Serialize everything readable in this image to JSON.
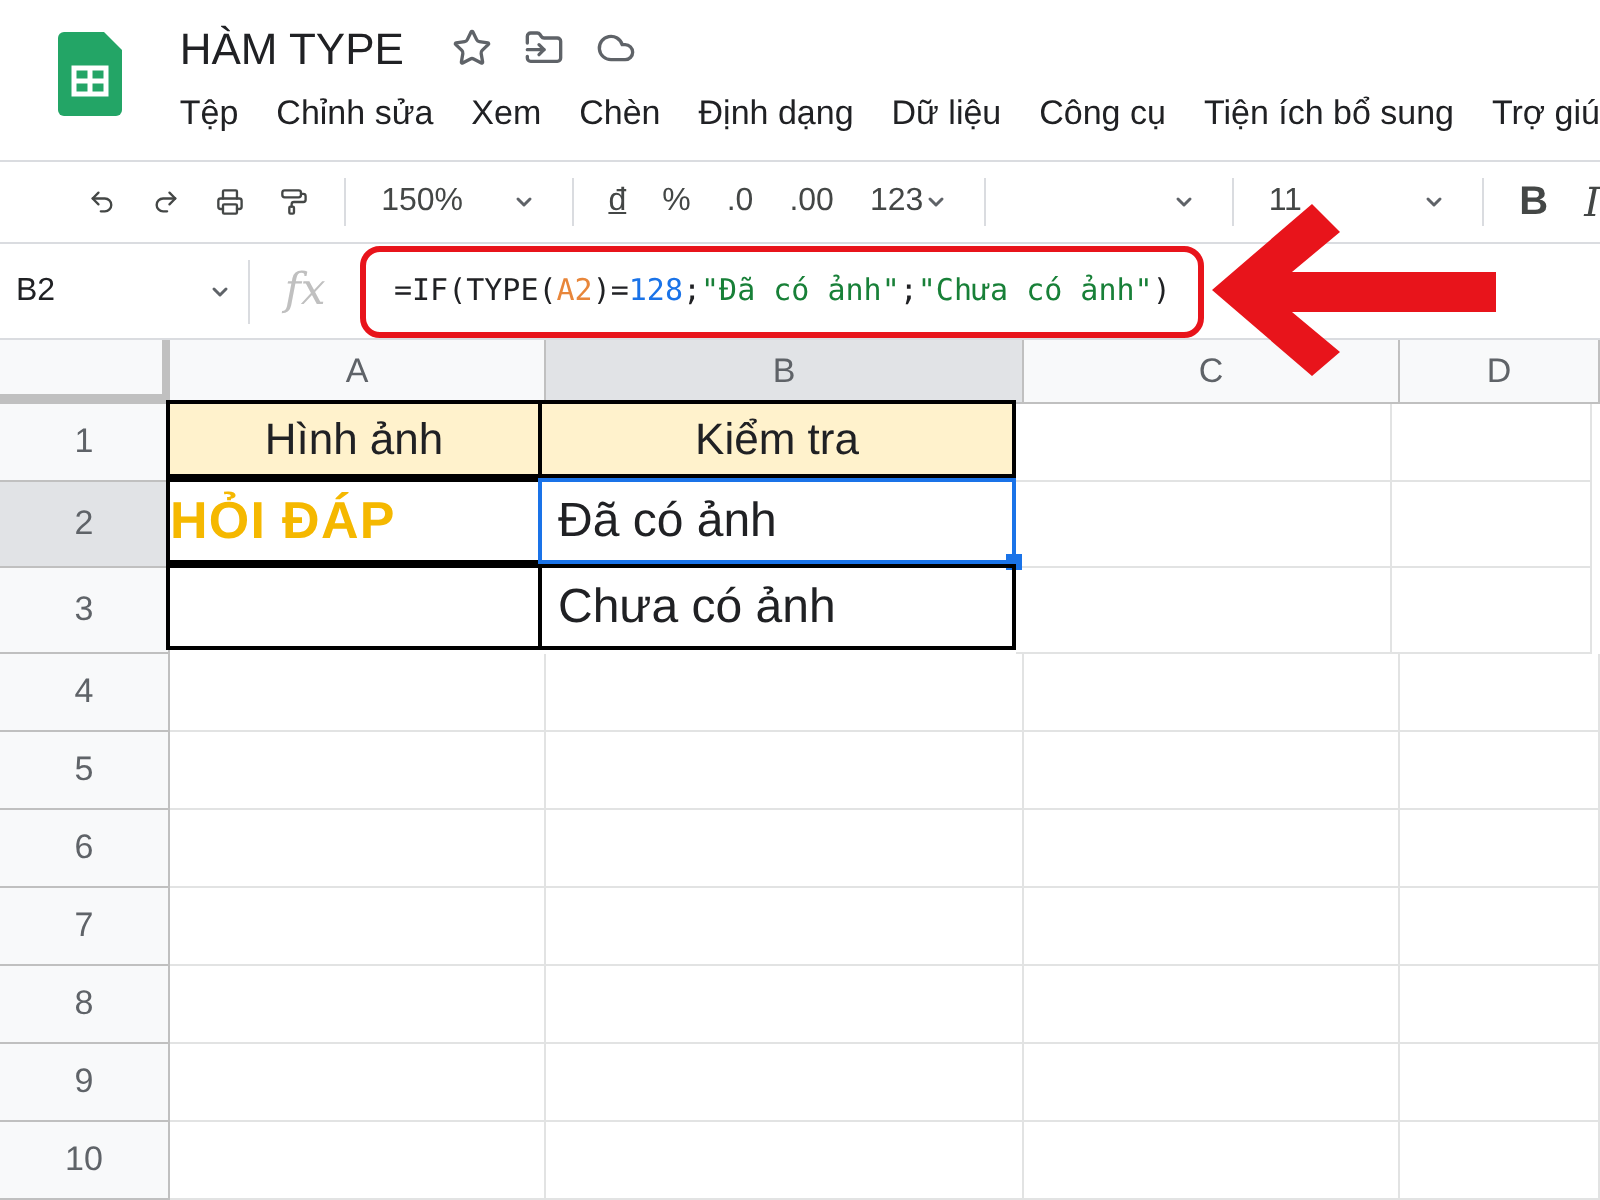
{
  "doc": {
    "title": "HÀM TYPE"
  },
  "menu": [
    "Tệp",
    "Chỉnh sửa",
    "Xem",
    "Chèn",
    "Định dạng",
    "Dữ liệu",
    "Công cụ",
    "Tiện ích bổ sung",
    "Trợ giú"
  ],
  "toolbar": {
    "zoom": "150%",
    "currency": "đ",
    "percent": "%",
    "decimal_less": ".0",
    "decimal_more": ".00",
    "format": "123",
    "font_size": "11",
    "bold": "B",
    "italic": "I"
  },
  "formula_bar": {
    "cell_ref": "B2",
    "fx": "fx",
    "formula": [
      {
        "kind": "text",
        "text": "=IF(TYPE("
      },
      {
        "kind": "ref",
        "text": "A2"
      },
      {
        "kind": "text",
        "text": ")="
      },
      {
        "kind": "number",
        "text": "128"
      },
      {
        "kind": "text",
        "text": ";"
      },
      {
        "kind": "string",
        "text": "\"Đã có ảnh\""
      },
      {
        "kind": "text",
        "text": ";"
      },
      {
        "kind": "string",
        "text": "\"Chưa có ảnh\""
      },
      {
        "kind": "text",
        "text": ")"
      }
    ]
  },
  "columns": [
    {
      "label": "A",
      "selected": false
    },
    {
      "label": "B",
      "selected": true
    },
    {
      "label": "C",
      "selected": false
    },
    {
      "label": "D",
      "selected": false
    }
  ],
  "rows": [
    {
      "label": "1",
      "selected": false,
      "cells": [
        {
          "kind": "header",
          "text": "Hình ảnh"
        },
        {
          "kind": "header",
          "text": "Kiểm tra",
          "selected": false
        }
      ]
    },
    {
      "label": "2",
      "selected": true,
      "cells": [
        {
          "kind": "image",
          "text": "HỎI ĐÁP"
        },
        {
          "kind": "text",
          "text": "Đã có ảnh",
          "selected": true
        }
      ]
    },
    {
      "label": "3",
      "selected": false,
      "cells": [
        {
          "kind": "empty"
        },
        {
          "kind": "text",
          "text": "Chưa có ảnh",
          "selected": false
        }
      ]
    },
    {
      "label": "4",
      "selected": false
    },
    {
      "label": "5",
      "selected": false
    },
    {
      "label": "6",
      "selected": false
    },
    {
      "label": "7",
      "selected": false
    },
    {
      "label": "8",
      "selected": false
    },
    {
      "label": "9",
      "selected": false
    },
    {
      "label": "10",
      "selected": false
    }
  ]
}
